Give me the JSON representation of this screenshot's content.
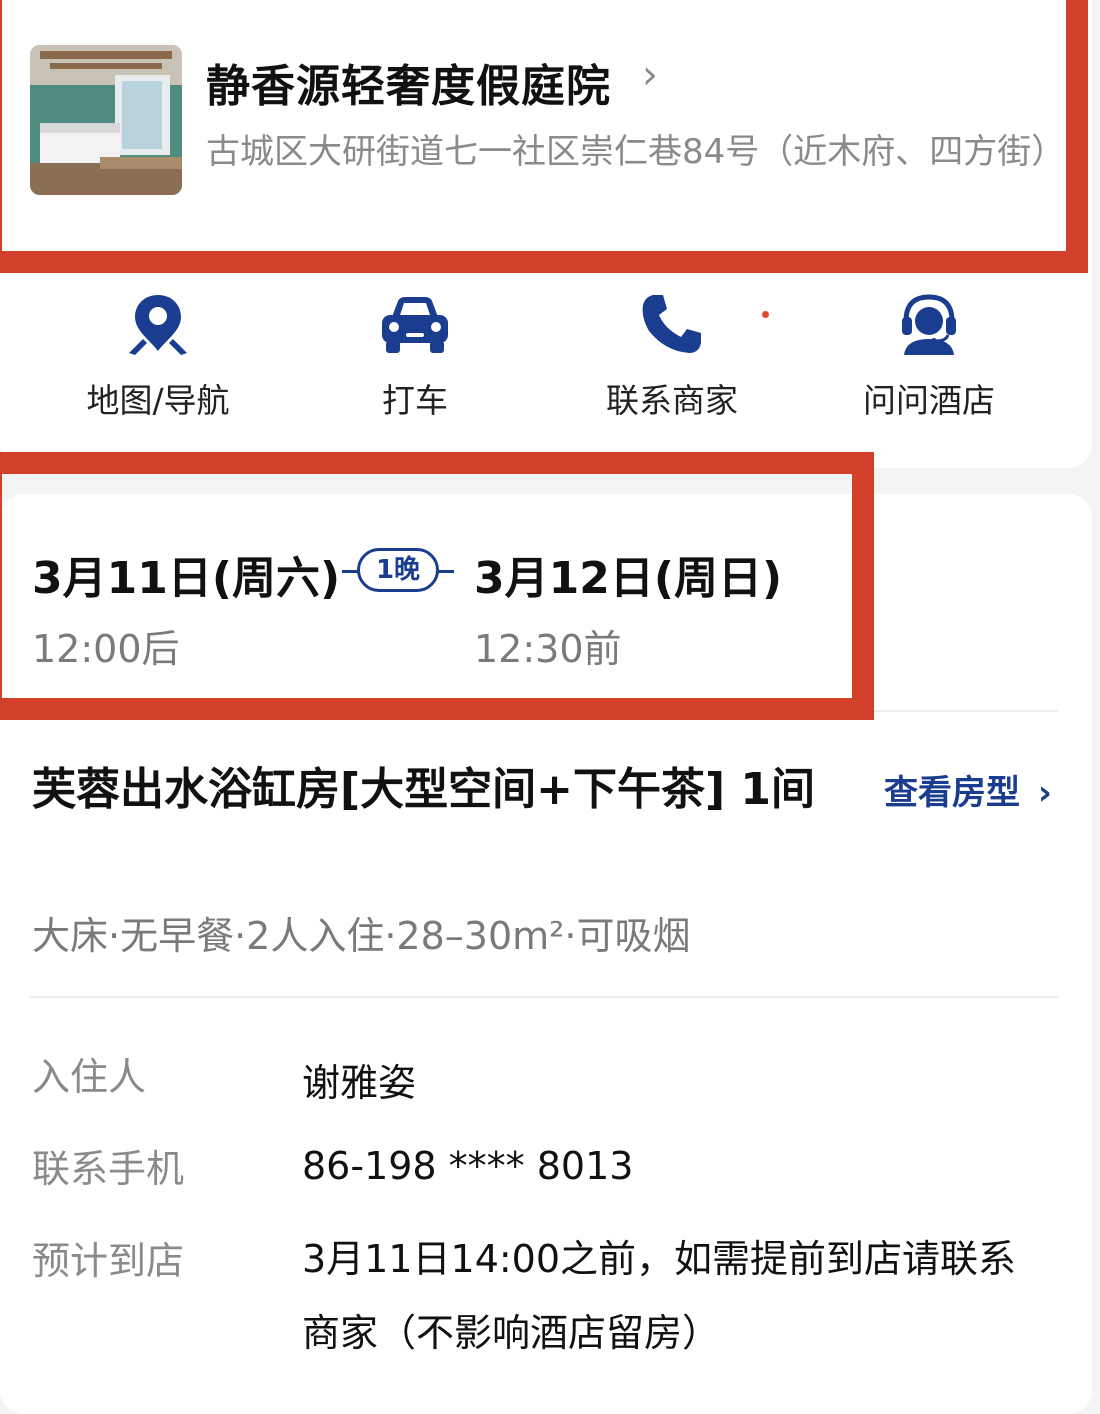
{
  "hotel": {
    "name": "静香源轻奢度假庭院",
    "address": "古城区大研街道七一社区崇仁巷84号（近木府、四方街）"
  },
  "actions": [
    {
      "label": "地图/导航",
      "icon": "map-pin-icon"
    },
    {
      "label": "打车",
      "icon": "car-icon"
    },
    {
      "label": "联系商家",
      "icon": "phone-icon"
    },
    {
      "label": "问问酒店",
      "icon": "customer-service-icon"
    }
  ],
  "stay": {
    "checkin_date": "3月11日(周六)",
    "checkin_time": "12:00后",
    "nights": "1晚",
    "checkout_date": "3月12日(周日)",
    "checkout_time": "12:30前"
  },
  "room": {
    "name": "芙蓉出水浴缸房[大型空间+下午茶] 1间",
    "view_label": "查看房型",
    "spec": "大床·无早餐·2人入住·28–30m²·可吸烟"
  },
  "guest": {
    "guest_label": "入住人",
    "guest_value": "谢雅姿",
    "phone_label": "联系手机",
    "phone_value": "86-198 **** 8013",
    "arrival_label": "预计到店",
    "arrival_value": "3月11日14:00之前，如需提前到店请联系商家（不影响酒店留房）"
  },
  "colors": {
    "accent": "#1a3d8f",
    "highlight_frame": "#d23f2b"
  }
}
